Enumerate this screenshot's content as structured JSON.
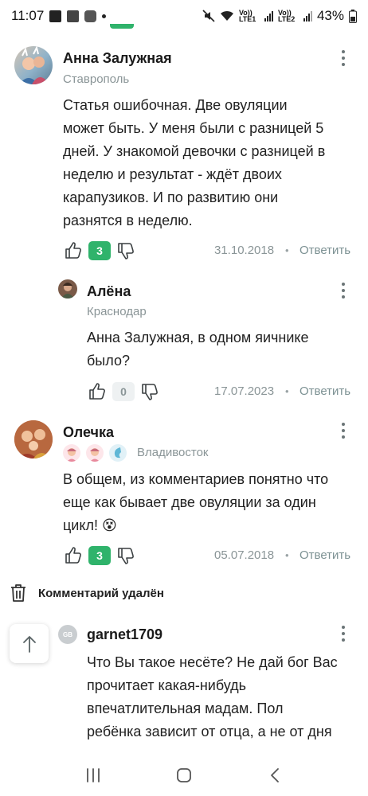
{
  "status_bar": {
    "time": "11:07",
    "battery": "43%",
    "sim1_label": "Vo)) LTE1",
    "sim2_label": "Vo)) LTE2"
  },
  "comments": [
    {
      "author": "Анна Залужная",
      "city": "Ставрополь",
      "text_lines": [
        "Статья ошибочная. Две овуляции",
        "может быть. У меня были с разницей 5",
        "дней. У знакомой девочки с разницей в",
        "неделю и результат - ждёт двоих",
        "карапузиков. И по развитию они",
        "разнятся в неделю."
      ],
      "likes": "3",
      "date": "31.10.2018",
      "reply_label": "Ответить"
    },
    {
      "author": "Алёна",
      "city": "Краснодар",
      "text_lines": [
        "Анна Залужная, в одном яичнике",
        "было?"
      ],
      "likes": "0",
      "date": "17.07.2023",
      "reply_label": "Ответить"
    },
    {
      "author": "Олечка",
      "city": "Владивосток",
      "text_lines": [
        "В общем, из комментариев понятно что",
        "еще как бывает две овуляции за один",
        "цикл! 😵"
      ],
      "likes": "3",
      "date": "05.07.2018",
      "reply_label": "Ответить"
    },
    {
      "author": "garnet1709",
      "avatar_initials": "GB",
      "text_lines": [
        "Что Вы такое несёте? Не дай бог Вас",
        "прочитает какая-нибудь",
        "впечатлительная мадам. Пол",
        "ребёнка зависит от отца, а не от дня"
      ]
    }
  ],
  "deleted_comment": {
    "label": "Комментарий удалён"
  },
  "separator": "•",
  "colors": {
    "accent_green": "#2fb36b",
    "muted_text": "#8a9597",
    "link_gray": "#7c9193"
  },
  "icons": {
    "like": "thumb-up-icon",
    "dislike": "thumb-down-icon",
    "menu": "kebab-menu-icon",
    "trash": "trash-icon",
    "scroll_up": "arrow-up-icon"
  }
}
